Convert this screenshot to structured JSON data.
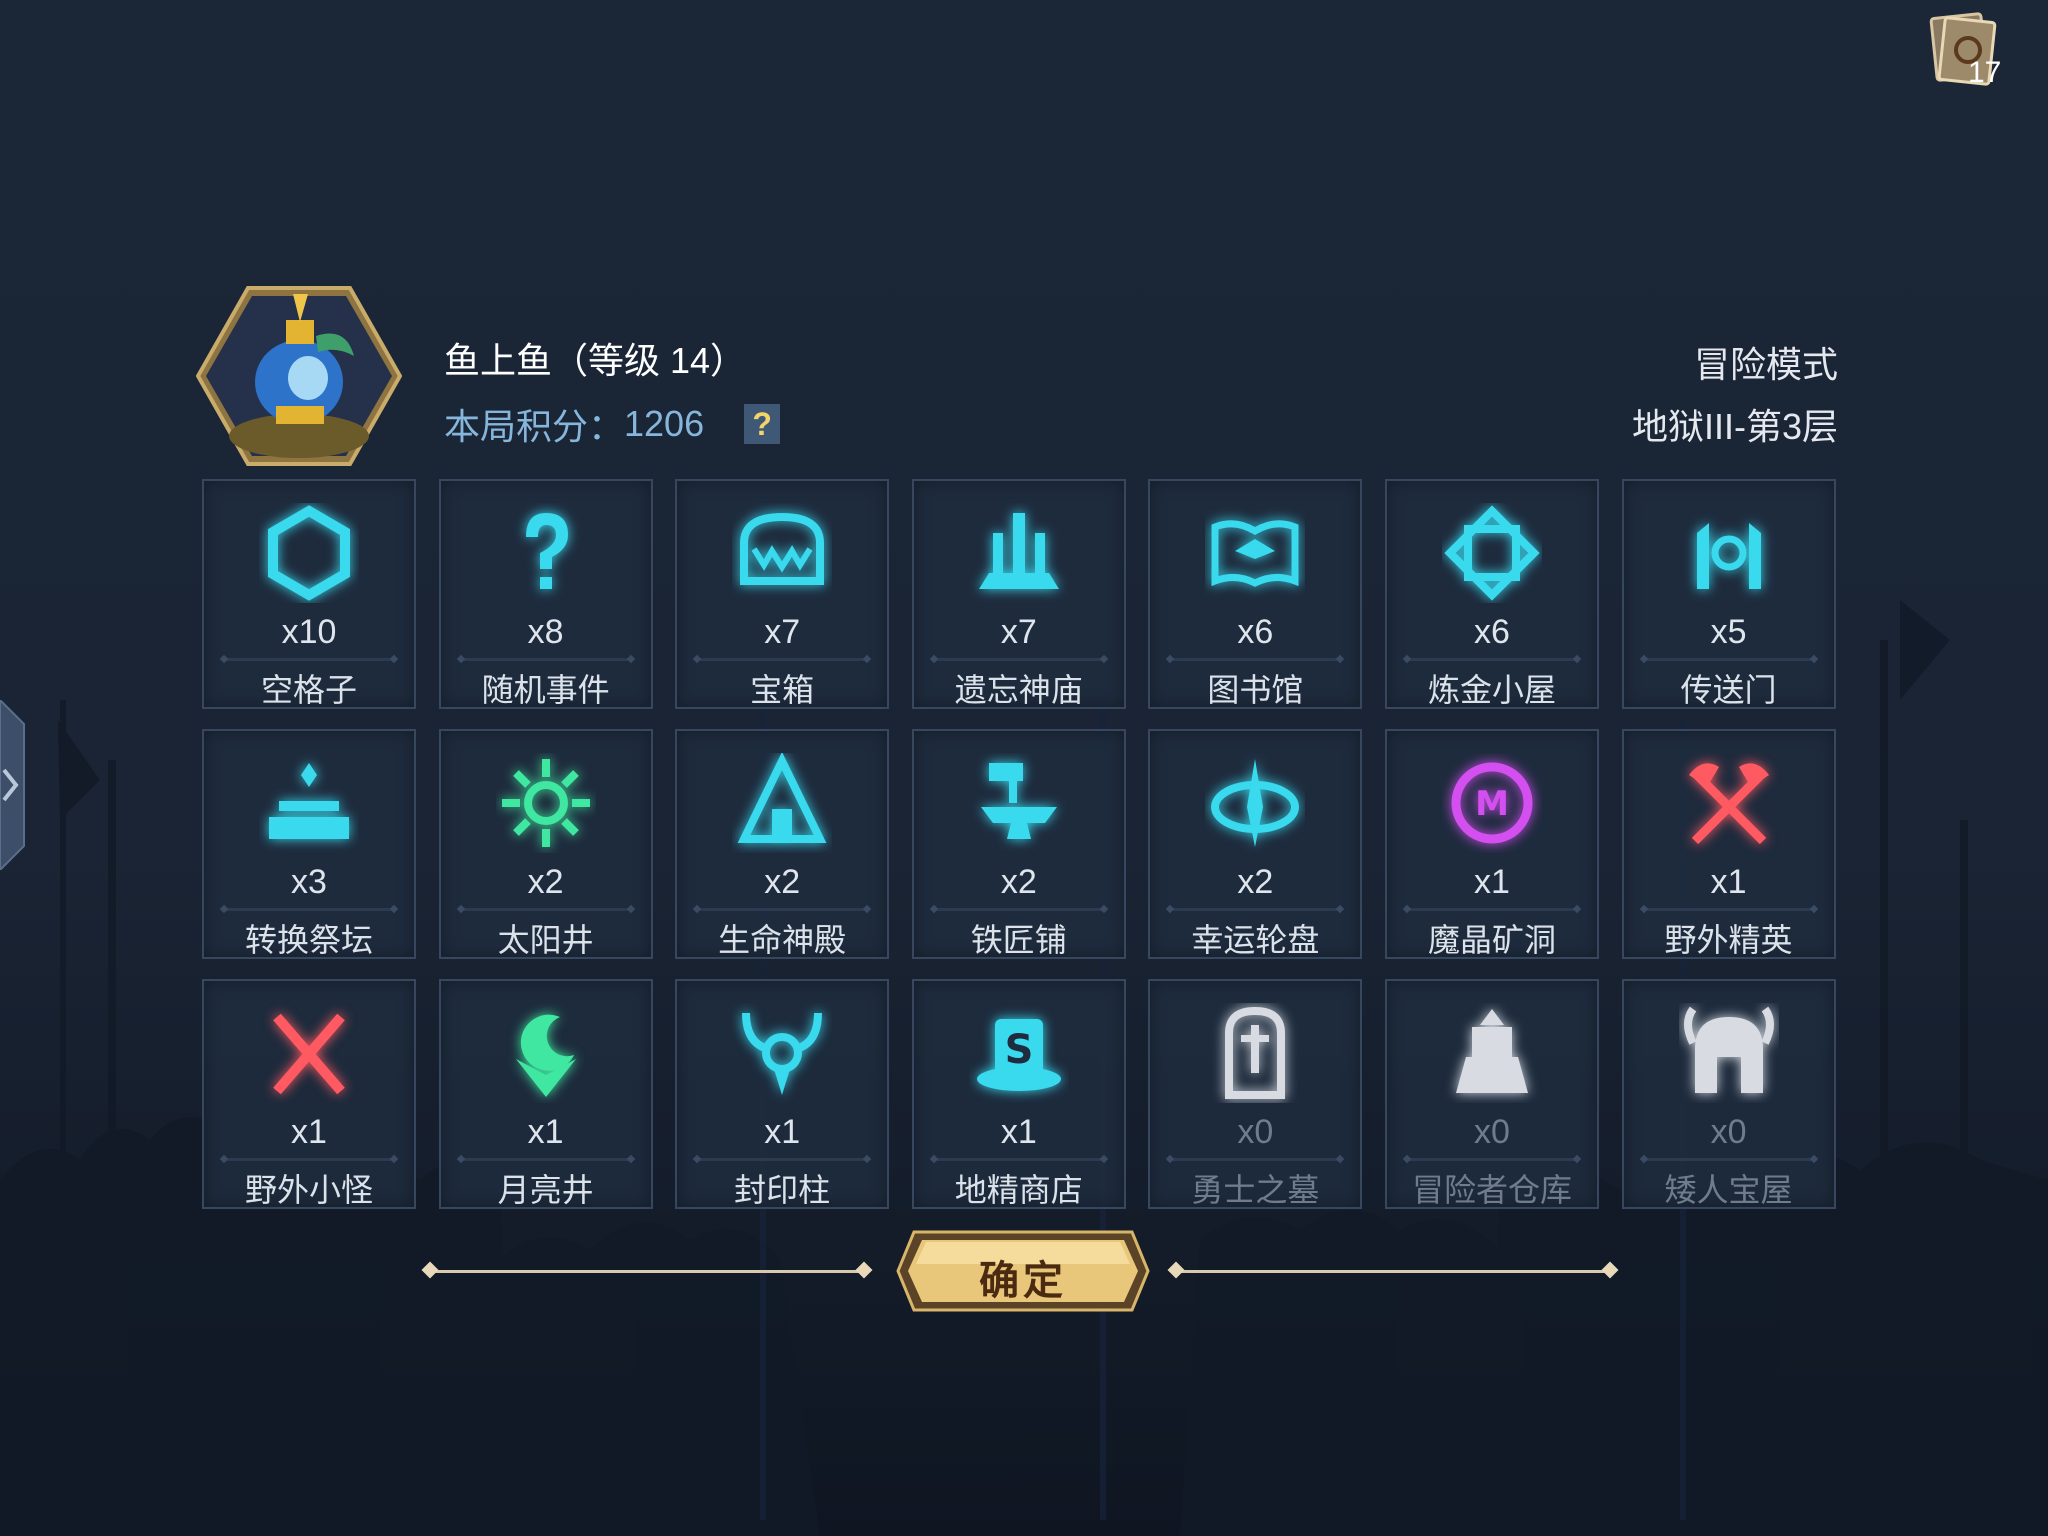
{
  "header": {
    "deck_count": "17",
    "player_name": "鱼上鱼（等级 14）",
    "score_label": "本局积分：",
    "score_value": "1206",
    "help_label": "?",
    "mode": "冒险模式",
    "level": "地狱III-第3层"
  },
  "tiles": [
    {
      "count": "x10",
      "label": "空格子",
      "icon": "hexagon-icon",
      "color": "#39d9ee",
      "dim": false
    },
    {
      "count": "x8",
      "label": "随机事件",
      "icon": "question-mark-icon",
      "color": "#39d9ee",
      "dim": false
    },
    {
      "count": "x7",
      "label": "宝箱",
      "icon": "treasure-chest-icon",
      "color": "#39d9ee",
      "dim": false
    },
    {
      "count": "x7",
      "label": "遗忘神庙",
      "icon": "temple-icon",
      "color": "#39d9ee",
      "dim": false
    },
    {
      "count": "x6",
      "label": "图书馆",
      "icon": "open-book-icon",
      "color": "#39d9ee",
      "dim": false
    },
    {
      "count": "x6",
      "label": "炼金小屋",
      "icon": "alchemy-rune-icon",
      "color": "#39d9ee",
      "dim": false
    },
    {
      "count": "x5",
      "label": "传送门",
      "icon": "portal-icon",
      "color": "#39d9ee",
      "dim": false
    },
    {
      "count": "x3",
      "label": "转换祭坛",
      "icon": "altar-icon",
      "color": "#39d9ee",
      "dim": false
    },
    {
      "count": "x2",
      "label": "太阳井",
      "icon": "sun-well-icon",
      "color": "#3fe7a0",
      "dim": false
    },
    {
      "count": "x2",
      "label": "生命神殿",
      "icon": "life-shrine-icon",
      "color": "#39d9ee",
      "dim": false
    },
    {
      "count": "x2",
      "label": "铁匠铺",
      "icon": "anvil-hammer-icon",
      "color": "#39d9ee",
      "dim": false
    },
    {
      "count": "x2",
      "label": "幸运轮盘",
      "icon": "fortune-wheel-icon",
      "color": "#39d9ee",
      "dim": false
    },
    {
      "count": "x1",
      "label": "魔晶矿洞",
      "icon": "crystal-mine-icon",
      "color": "#d34ff0",
      "dim": false
    },
    {
      "count": "x1",
      "label": "野外精英",
      "icon": "crossed-axes-icon",
      "color": "#ff5a62",
      "dim": false
    },
    {
      "count": "x1",
      "label": "野外小怪",
      "icon": "crossed-swords-icon",
      "color": "#ff5a62",
      "dim": false
    },
    {
      "count": "x1",
      "label": "月亮井",
      "icon": "moon-well-icon",
      "color": "#3fe7a0",
      "dim": false
    },
    {
      "count": "x1",
      "label": "封印柱",
      "icon": "seal-pillar-icon",
      "color": "#39d9ee",
      "dim": false
    },
    {
      "count": "x1",
      "label": "地精商店",
      "icon": "goblin-shop-icon",
      "color": "#39d9ee",
      "dim": false
    },
    {
      "count": "x0",
      "label": "勇士之墓",
      "icon": "tombstone-icon",
      "color": "#e8ecf1",
      "dim": true
    },
    {
      "count": "x0",
      "label": "冒险者仓库",
      "icon": "warehouse-icon",
      "color": "#e8ecf1",
      "dim": true
    },
    {
      "count": "x0",
      "label": "矮人宝屋",
      "icon": "dwarf-helmet-icon",
      "color": "#e8ecf1",
      "dim": true
    }
  ],
  "confirm_label": "确定"
}
